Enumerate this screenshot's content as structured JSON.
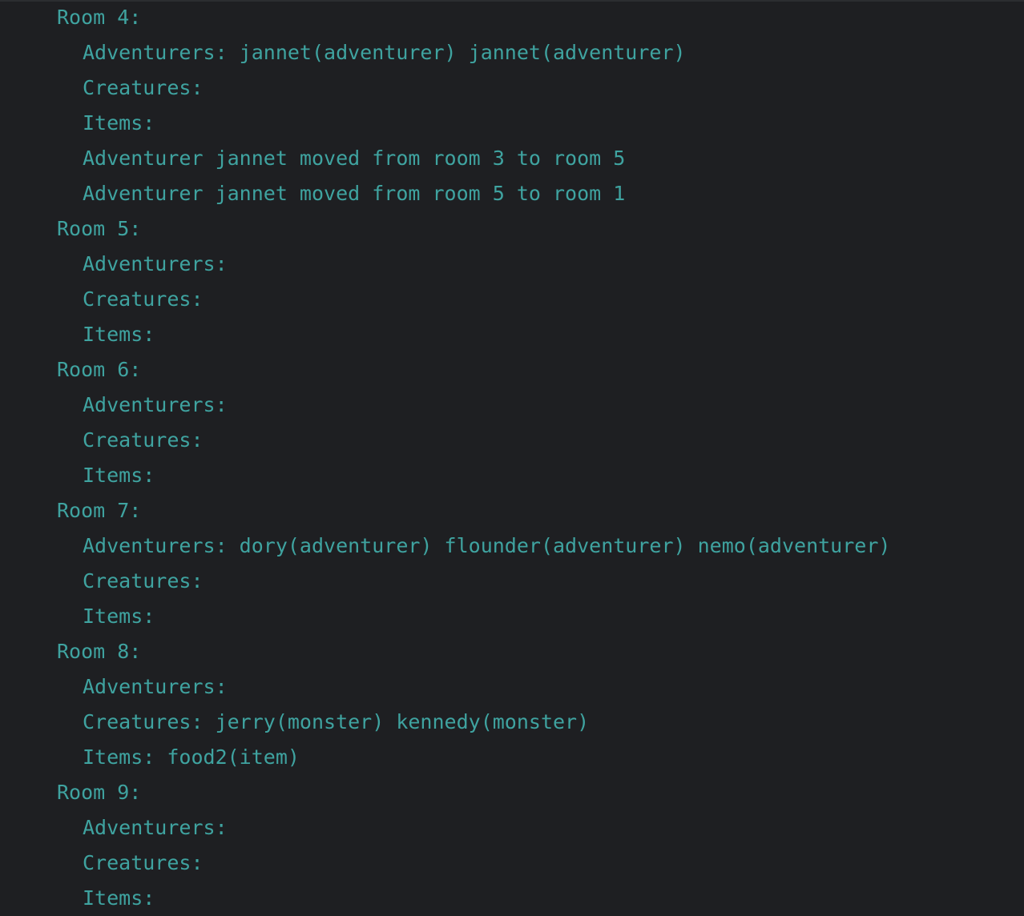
{
  "console": {
    "lines": [
      {
        "text": "Room 4:",
        "level": 0
      },
      {
        "text": "Adventurers: jannet(adventurer) jannet(adventurer)",
        "level": 1
      },
      {
        "text": "Creatures:",
        "level": 1
      },
      {
        "text": "Items:",
        "level": 1
      },
      {
        "text": "Adventurer jannet moved from room 3 to room 5",
        "level": 1
      },
      {
        "text": "Adventurer jannet moved from room 5 to room 1",
        "level": 1
      },
      {
        "text": "Room 5:",
        "level": 0
      },
      {
        "text": "Adventurers:",
        "level": 1
      },
      {
        "text": "Creatures:",
        "level": 1
      },
      {
        "text": "Items:",
        "level": 1
      },
      {
        "text": "Room 6:",
        "level": 0
      },
      {
        "text": "Adventurers:",
        "level": 1
      },
      {
        "text": "Creatures:",
        "level": 1
      },
      {
        "text": "Items:",
        "level": 1
      },
      {
        "text": "Room 7:",
        "level": 0
      },
      {
        "text": "Adventurers: dory(adventurer) flounder(adventurer) nemo(adventurer)",
        "level": 1
      },
      {
        "text": "Creatures:",
        "level": 1
      },
      {
        "text": "Items:",
        "level": 1
      },
      {
        "text": "Room 8:",
        "level": 0
      },
      {
        "text": "Adventurers:",
        "level": 1
      },
      {
        "text": "Creatures: jerry(monster) kennedy(monster)",
        "level": 1
      },
      {
        "text": "Items: food2(item)",
        "level": 1
      },
      {
        "text": "Room 9:",
        "level": 0
      },
      {
        "text": "Adventurers:",
        "level": 1
      },
      {
        "text": "Creatures:",
        "level": 1
      },
      {
        "text": "Items:",
        "level": 1
      }
    ],
    "text_color": "#3fa3a0",
    "background_color": "#1e1f22"
  }
}
